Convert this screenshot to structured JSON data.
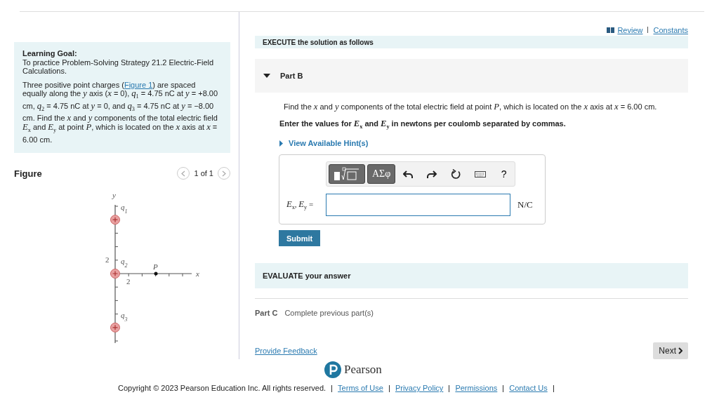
{
  "header": {
    "review_link": "Review",
    "constants_link": "Constants"
  },
  "learning_goal": {
    "title": "Learning Goal:",
    "text": "To practice Problem-Solving Strategy 21.2 Electric-Field Calculations.",
    "problem_before": "Three positive point charges (",
    "figure_link": "Figure 1",
    "problem_after": ") are spaced equally along the *y* axis (*x* = 0), *q*$_{1}$ = 4.75 nC at *y* = +8.00 cm, *q*$_{2}$ = 4.75 nC at *y* = 0, and *q*$_{3}$ = 4.75 nC at *y* = −8.00 cm.  Find the *x* and *y* components of the total electric field *E*$_{x}$ and *E*$_{y}$ at point *P*, which is located on the *x* axis at *x* = 6.00 cm."
  },
  "figure_panel": {
    "title": "Figure",
    "pager": "1 of 1"
  },
  "diagram": {
    "y_axis_label": "y",
    "x_axis_label": "x",
    "y_tick_label": "2",
    "x_tick_label": "2",
    "point_label": "P",
    "charges": [
      {
        "name": "q",
        "index": "1"
      },
      {
        "name": "q",
        "index": "2"
      },
      {
        "name": "q",
        "index": "3"
      }
    ]
  },
  "execute_banner": "EXECUTE the solution as follows",
  "part_b": {
    "title": "Part B",
    "expanded": true,
    "question": "Find the *x* and *y* components of the total electric field at point *P*, which is located on the *x* axis at *x* = 6.00 cm.",
    "instruction": "Enter the values for *E*$_{x}$ and *E*$_{y}$ in newtons per coulomb separated by commas.",
    "hint_link": "View Available Hint(s)",
    "toolbar": [
      {
        "kind": "templates"
      },
      {
        "kind": "symbols",
        "label": "ΑΣφ"
      },
      {
        "kind": "undo"
      },
      {
        "kind": "redo"
      },
      {
        "kind": "reset"
      },
      {
        "kind": "keyboard"
      },
      {
        "kind": "help",
        "label": "?"
      }
    ],
    "answer_label": "*E*$_{x}$, *E*$_{y}$ =",
    "unit": "N/C",
    "submit": "Submit"
  },
  "evaluate_banner": "EVALUATE your answer",
  "part_c": {
    "title": "Part C",
    "status": "Complete previous part(s)"
  },
  "feedback_link": "Provide Feedback",
  "next_button": "Next",
  "brand": "Pearson",
  "footer": {
    "copyright": "Copyright © 2023 Pearson Education Inc. All rights reserved.",
    "links": [
      "Terms of Use",
      "Privacy Policy",
      "Permissions",
      "Contact Us"
    ]
  }
}
